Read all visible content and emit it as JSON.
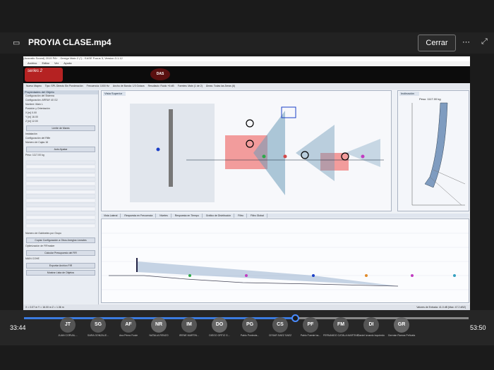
{
  "app": {
    "title": "PROYIA CLASE.mp4",
    "close_label": "Cerrar",
    "more_icon": "⋯",
    "ext_icon": "⤢"
  },
  "player": {
    "elapsed": "33:44",
    "remaining": "53:50",
    "progress": 0.61
  },
  "window": {
    "title": "(Acoustic Sound) 2019 PA+ - Design Main 2 (*) - EASE Focus 3, Version 3.1.12",
    "menu": [
      "Archivo",
      "Editar",
      "Ver",
      "Ayuda"
    ]
  },
  "banner": {
    "logo": "series 2",
    "das": "DAS"
  },
  "toolbar": {
    "items": [
      "Nuevo Mapeo",
      "Tipo: SPL Directo Sin Ponderación",
      "Frecuencia: 1000 Hz",
      "Ancho de Banda: 1/3 Octava",
      "Resultado: Ruido +6 dB",
      "Fuentes: Main (1 de 2)",
      "Áreas: Todas las Áreas (6)"
    ]
  },
  "left": {
    "head": "Propiedades del Objeto",
    "rows": [
      "Configuración del Sistema",
      "Configuración: ARRAY 40 G2",
      "Nombre: Main L",
      "Posición y Orientación",
      "X [m] 0.00",
      "Y [m] 16.00",
      "Z [m] 12.00",
      "Instalación",
      "Configuración del Rifle",
      "Número de Cajas 16",
      "Peso: 1117.00 kg",
      "Número de Gabinetes por Grupo",
      "Optimización de FIRmaker",
      "MAIN COHE"
    ],
    "buttons": [
      "Límite de Mares",
      "Auto Ajustar",
      "Copiar Configuración a Otros Arreglos Lineales",
      "Calcular Presupuesto del FIR",
      "Exportar Archivo FIR",
      "Mostrar Lista de Objetos"
    ]
  },
  "plan": {
    "tab": "Vista Superior"
  },
  "incl": {
    "tab": "Inclinación",
    "label": "Peso: 1117.00 kg"
  },
  "tabs": [
    "Vista Lateral",
    "Respuesta en Frecuencia",
    "Niveles",
    "Respuesta en Tiempo",
    "Gráfico de Distribución",
    "Filtro",
    "Filtro Global"
  ],
  "status": {
    "left": "X = 0.07 m  Y = 16.00 m  Z = 1.36 m",
    "right": "Valores de Entrada: 41.0 dB (Max: 47.2 dBZ)"
  },
  "participants": [
    {
      "initials": "JT",
      "name": "JUAN CORVAL...",
      "color": "#555"
    },
    {
      "initials": "SG",
      "name": "SARA GONZALE...",
      "color": "#555"
    },
    {
      "initials": "AF",
      "name": "Ana Pérez Fuste",
      "color": "#555"
    },
    {
      "initials": "NR",
      "name": "NATALIA RENZO",
      "color": "#666"
    },
    {
      "initials": "IM",
      "name": "IRENE MARTIN...",
      "color": "#555"
    },
    {
      "initials": "DO",
      "name": "DIEGO ORTIZ G...",
      "color": "#666"
    },
    {
      "initials": "PG",
      "name": "Pablo Pontevia...",
      "color": "#555"
    },
    {
      "initials": "CS",
      "name": "CESAR SAEZ SAEZ",
      "color": "#555"
    },
    {
      "initials": "PF",
      "name": "Pablo Fuente ba...",
      "color": "#555"
    },
    {
      "initials": "FM",
      "name": "FERNANDO CATALA MARTINEZ",
      "color": "#555"
    },
    {
      "initials": "DI",
      "name": "Daniel Iznardo Izquierdo",
      "color": "#555"
    },
    {
      "initials": "GR",
      "name": "Germán Ramos Peñuela",
      "color": "#666"
    }
  ]
}
